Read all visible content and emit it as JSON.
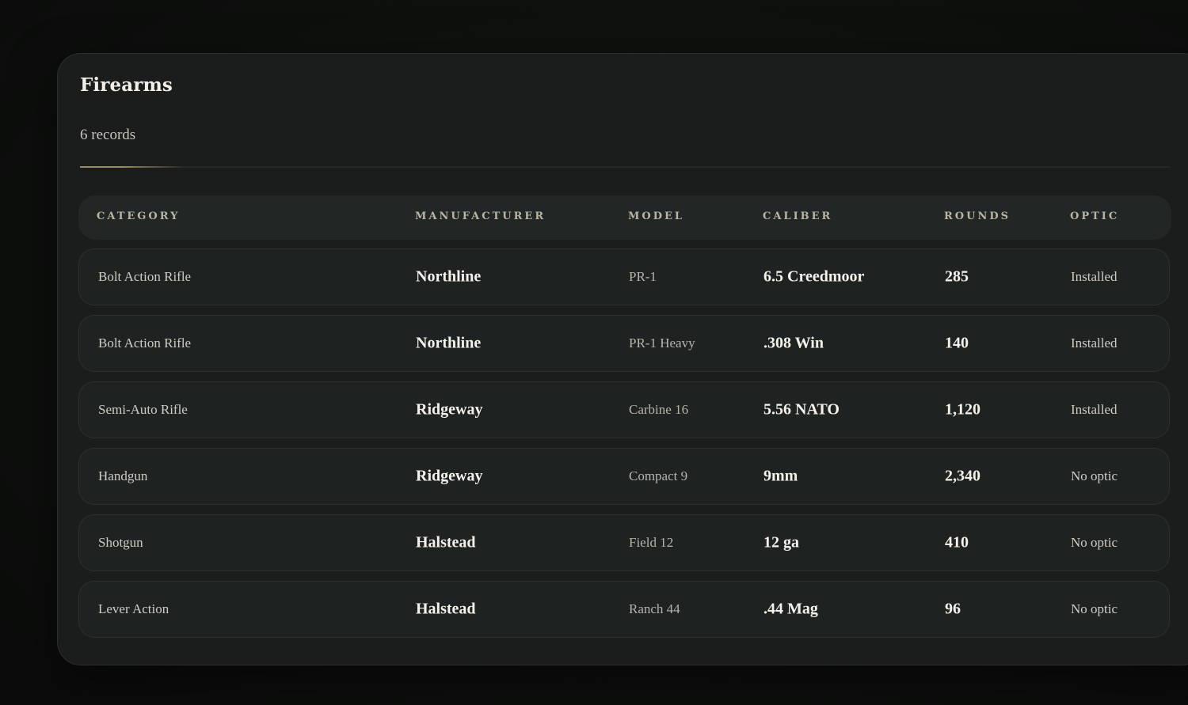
{
  "panel": {
    "title": "Firearms",
    "record_count": "6 records"
  },
  "table": {
    "headers": [
      "CATEGORY",
      "MANUFACTURER",
      "MODEL",
      "CALIBER",
      "ROUNDS",
      "OPTIC"
    ],
    "rows": [
      {
        "category": "Bolt Action Rifle",
        "manufacturer": "Northline",
        "model": "PR-1",
        "caliber": "6.5 Creedmoor",
        "rounds": "285",
        "optic": "Installed"
      },
      {
        "category": "Bolt Action Rifle",
        "manufacturer": "Northline",
        "model": "PR-1 Heavy",
        "caliber": ".308 Win",
        "rounds": "140",
        "optic": "Installed"
      },
      {
        "category": "Semi-Auto Rifle",
        "manufacturer": "Ridgeway",
        "model": "Carbine 16",
        "caliber": "5.56 NATO",
        "rounds": "1,120",
        "optic": "Installed"
      },
      {
        "category": "Handgun",
        "manufacturer": "Ridgeway",
        "model": "Compact 9",
        "caliber": "9mm",
        "rounds": "2,340",
        "optic": "No optic"
      },
      {
        "category": "Shotgun",
        "manufacturer": "Halstead",
        "model": "Field 12",
        "caliber": "12 ga",
        "rounds": "410",
        "optic": "No optic"
      },
      {
        "category": "Lever Action",
        "manufacturer": "Halstead",
        "model": "Ranch 44",
        "caliber": ".44 Mag",
        "rounds": "96",
        "optic": "No optic"
      }
    ]
  },
  "colors": {
    "background": "#0e100e",
    "panel": "#1a1d1b",
    "accent": "#a08a62",
    "header_text": "#b9b4a6"
  }
}
